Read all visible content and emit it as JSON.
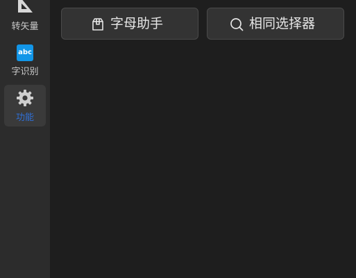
{
  "sidebar": {
    "items": [
      {
        "label": "转矢量",
        "icon": "ruler-triangle-icon",
        "active": false
      },
      {
        "label": "字识别",
        "icon": "abc-icon",
        "icon_text": "abc",
        "icon_color": "#1296e8",
        "active": false
      },
      {
        "label": "功能",
        "icon": "gear-icon",
        "active": true,
        "label_color": "#2f6fd6"
      }
    ]
  },
  "toolbar": {
    "buttons": [
      {
        "label": "字母助手",
        "icon": "package-icon"
      },
      {
        "label": "相同选择器",
        "icon": "search-icon"
      }
    ]
  },
  "colors": {
    "background": "#1e1e1e",
    "sidebar": "#2c2c2c",
    "button": "#333333",
    "accent": "#2f6fd6"
  }
}
